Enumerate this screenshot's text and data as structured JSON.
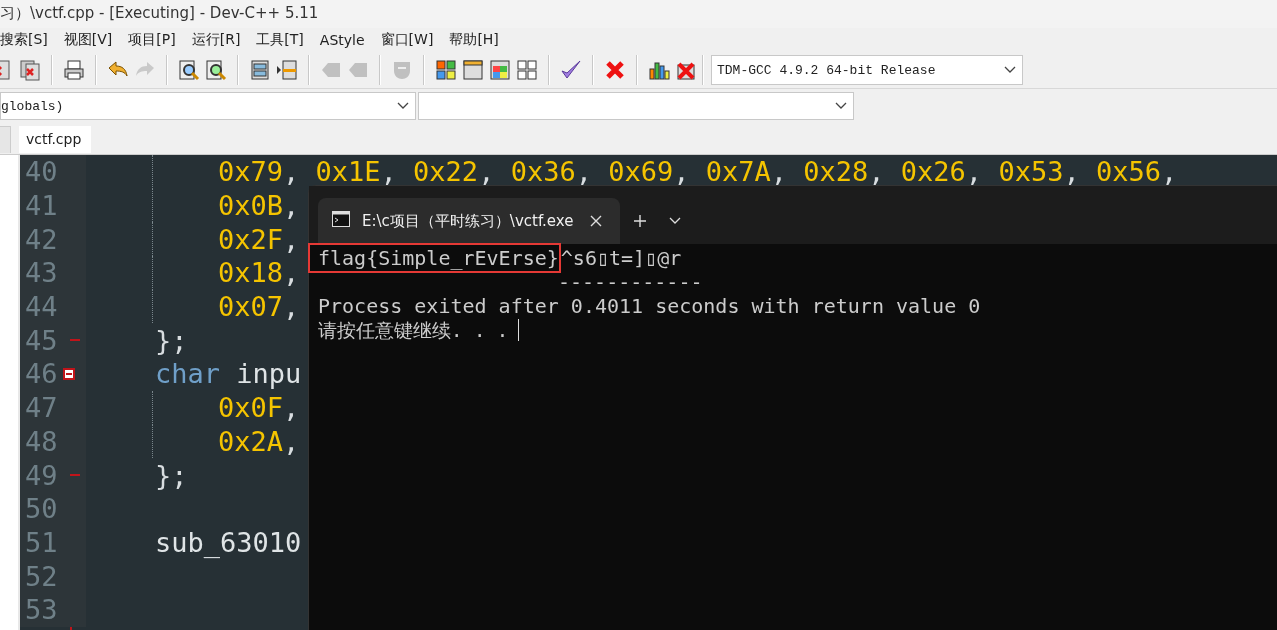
{
  "window": {
    "title": "习）\\vctf.cpp - [Executing] - Dev-C++ 5.11"
  },
  "menu": [
    {
      "label": "搜索[S]"
    },
    {
      "label": "视图[V]"
    },
    {
      "label": "项目[P]"
    },
    {
      "label": "运行[R]"
    },
    {
      "label": "工具[T]"
    },
    {
      "label": "AStyle"
    },
    {
      "label": "窗口[W]"
    },
    {
      "label": "帮助[H]"
    }
  ],
  "toolbar": [
    {
      "kind": "close-doc",
      "disabled": false
    },
    {
      "kind": "close-all",
      "disabled": false
    },
    {
      "kind": "sep"
    },
    {
      "kind": "print",
      "disabled": false
    },
    {
      "kind": "sep"
    },
    {
      "kind": "undo",
      "disabled": false
    },
    {
      "kind": "redo",
      "disabled": true
    },
    {
      "kind": "sep"
    },
    {
      "kind": "find",
      "disabled": false
    },
    {
      "kind": "replace",
      "disabled": false
    },
    {
      "kind": "sep"
    },
    {
      "kind": "indent",
      "disabled": false
    },
    {
      "kind": "unindent",
      "disabled": false
    },
    {
      "kind": "sep"
    },
    {
      "kind": "bookmark",
      "disabled": true
    },
    {
      "kind": "goto",
      "disabled": true
    },
    {
      "kind": "sep"
    },
    {
      "kind": "shield",
      "disabled": true
    },
    {
      "kind": "sep"
    },
    {
      "kind": "color-grid",
      "disabled": false
    },
    {
      "kind": "window",
      "disabled": false
    },
    {
      "kind": "color-window",
      "disabled": false
    },
    {
      "kind": "grid",
      "disabled": false
    },
    {
      "kind": "sep"
    },
    {
      "kind": "check",
      "disabled": false
    },
    {
      "kind": "sep"
    },
    {
      "kind": "stop",
      "disabled": false
    },
    {
      "kind": "sep"
    },
    {
      "kind": "chart",
      "disabled": false
    },
    {
      "kind": "chart-stop",
      "disabled": false
    }
  ],
  "compiler": {
    "value": "TDM-GCC 4.9.2 64-bit Release"
  },
  "scope": {
    "value": "globals)"
  },
  "editor_tabs": [
    {
      "label": "vctf.cpp",
      "selected": true
    }
  ],
  "editor": {
    "lines": [
      {
        "children": [
          {
            "number": "40",
            "tokens": [
              {
                "kind": "number",
                "text": "0x79"
              },
              {
                "kind": "punct",
                "text": ", "
              },
              {
                "kind": "number",
                "text": "0x1E"
              },
              {
                "kind": "punct",
                "text": ", "
              },
              {
                "kind": "number",
                "text": "0x22"
              },
              {
                "kind": "punct",
                "text": ", "
              },
              {
                "kind": "number",
                "text": "0x36"
              },
              {
                "kind": "punct",
                "text": ", "
              },
              {
                "kind": "number",
                "text": "0x69"
              },
              {
                "kind": "punct",
                "text": ", "
              },
              {
                "kind": "number",
                "text": "0x7A"
              },
              {
                "kind": "punct",
                "text": ", "
              },
              {
                "kind": "number",
                "text": "0x28"
              },
              {
                "kind": "punct",
                "text": ", "
              },
              {
                "kind": "number",
                "text": "0x26"
              },
              {
                "kind": "punct",
                "text": ", "
              },
              {
                "kind": "number",
                "text": "0x53"
              },
              {
                "kind": "punct",
                "text": ", "
              },
              {
                "kind": "number",
                "text": "0x56"
              },
              {
                "kind": "punct",
                "text": ","
              }
            ]
          },
          {
            "number": "41",
            "tokens": [
              {
                "kind": "number",
                "text": "0x0B"
              },
              {
                "kind": "punct",
                "text": ","
              }
            ]
          },
          {
            "number": "42",
            "tokens": [
              {
                "kind": "number",
                "text": "0x2F"
              },
              {
                "kind": "punct",
                "text": ","
              }
            ]
          },
          {
            "number": "43",
            "tokens": [
              {
                "kind": "number",
                "text": "0x18"
              },
              {
                "kind": "punct",
                "text": ","
              }
            ]
          },
          {
            "number": "44",
            "tokens": [
              {
                "kind": "number",
                "text": "0x07"
              },
              {
                "kind": "punct",
                "text": ","
              }
            ]
          }
        ]
      },
      {
        "number": "45",
        "fold_end": true,
        "tokens": [
          {
            "kind": "punct",
            "text": "};"
          }
        ]
      },
      {
        "number": "46",
        "fold_start": true,
        "tokens": [
          {
            "kind": "keyword",
            "text": "char"
          },
          {
            "kind": "ident",
            "text": "inpu"
          }
        ],
        "children": [
          {
            "number": "47",
            "tokens": [
              {
                "kind": "number",
                "text": "0x0F"
              },
              {
                "kind": "punct",
                "text": ","
              }
            ]
          },
          {
            "number": "48",
            "tokens": [
              {
                "kind": "number",
                "text": "0x2A"
              },
              {
                "kind": "punct",
                "text": ","
              }
            ]
          }
        ]
      },
      {
        "number": "49",
        "fold_end": true,
        "tokens": [
          {
            "kind": "punct",
            "text": "};"
          }
        ]
      },
      {
        "number": "50"
      },
      {
        "number": "51",
        "tokens": [
          {
            "kind": "ident",
            "text": "sub_63010"
          }
        ]
      },
      {
        "number": "52"
      },
      {
        "number": "53"
      }
    ]
  },
  "terminal": {
    "tab": {
      "title": "E:\\c项目（平时练习）\\vctf.exe",
      "selected": true
    },
    "lines": [
      {
        "kind": "flag",
        "highlight": "flag{Simple_rEvErse}",
        "text": "^s6▯t=]▯@r"
      },
      {
        "kind": "rule",
        "text": "------------"
      },
      {
        "kind": "text",
        "text": "Process exited after 0.4011 seconds with return value 0"
      },
      {
        "kind": "prompt",
        "text": "请按任意键继续. . .",
        "cursor": true
      }
    ]
  }
}
